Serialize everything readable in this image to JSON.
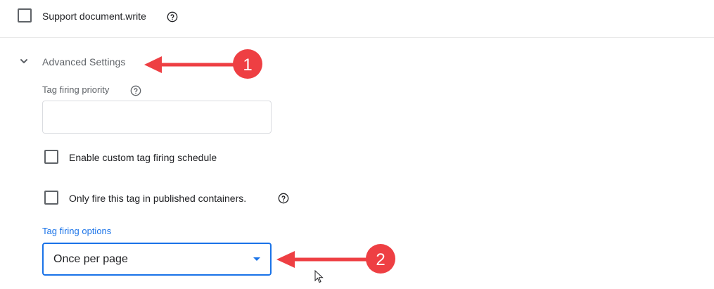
{
  "support_document_write": {
    "label": "Support document.write",
    "checked": false
  },
  "advanced_settings": {
    "title": "Advanced Settings",
    "expanded": true,
    "tag_firing_priority": {
      "label": "Tag firing priority",
      "value": "",
      "placeholder": ""
    },
    "custom_schedule": {
      "label": "Enable custom tag firing schedule",
      "checked": false
    },
    "published_only": {
      "label": "Only fire this tag in published containers.",
      "checked": false
    },
    "tag_firing_options": {
      "label": "Tag firing options",
      "selected": "Once per page"
    }
  },
  "annotations": [
    {
      "number": "1",
      "points_to": "advanced-settings-title"
    },
    {
      "number": "2",
      "points_to": "tag-firing-options-select"
    }
  ],
  "colors": {
    "accent": "#1a73e8",
    "annotation_red": "#ee3f43",
    "text": "#202124",
    "muted": "#5f6368",
    "border": "#dadce0"
  }
}
